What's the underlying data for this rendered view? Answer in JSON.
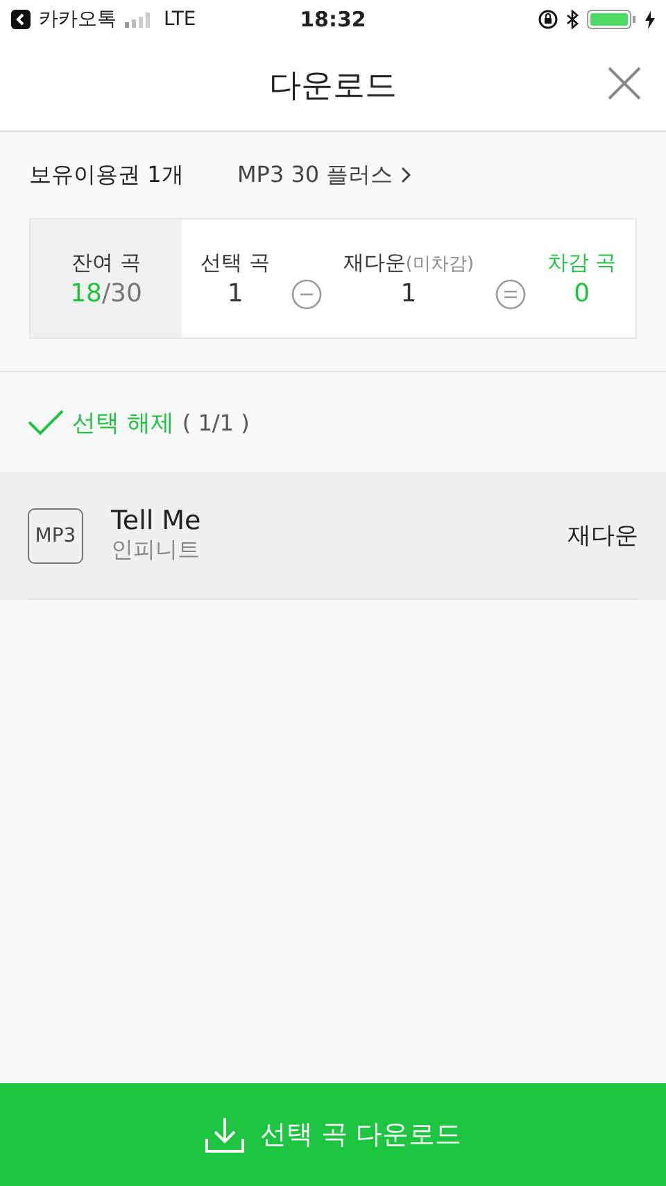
{
  "status_bar": {
    "back_app": "카카오톡",
    "network": "LTE",
    "time": "18:32"
  },
  "header": {
    "title": "다운로드"
  },
  "pass": {
    "label": "보유이용권 1개",
    "plan": "MP3 30 플러스"
  },
  "summary": {
    "remaining": {
      "label": "잔여 곡",
      "used": "18",
      "total": "/30"
    },
    "selected": {
      "label": "선택 곡",
      "value": "1"
    },
    "redownload": {
      "label": "재다운",
      "note": "(미차감)",
      "value": "1"
    },
    "deducted": {
      "label": "차감 곡",
      "value": "0"
    }
  },
  "selection": {
    "checked": true,
    "label": "선택 해제",
    "count": "( 1/1 )"
  },
  "tracks": [
    {
      "format": "MP3",
      "title": "Tell Me",
      "artist": "인피니트",
      "status": "재다운",
      "selected": true
    }
  ],
  "download_button": {
    "label": "선택 곡 다운로드"
  }
}
